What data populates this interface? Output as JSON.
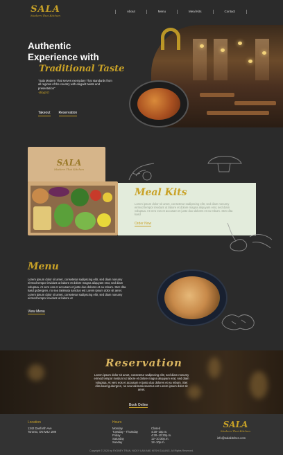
{
  "brand": {
    "logo_main": "SALA",
    "logo_sub": "Modern Thai Kitchen"
  },
  "nav": {
    "items": [
      "About",
      "Menu",
      "Meal Kits",
      "Contact"
    ]
  },
  "hero": {
    "headline_line1": "Authentic",
    "headline_line2": "Experience with",
    "script_title": "Traditional Taste",
    "quote": "\"Sala Modern Thai serves exemplary Thai standards from all regions of the country with elegant twists and presentation\"",
    "cite": "-BlogXO",
    "takeout_label": "Takeout",
    "reservation_label": "Reservation"
  },
  "meal_kits": {
    "title": "Meal Kits",
    "text": "Lorem ipsum dolor sit amet, consetetur sadipscing elitr, sed diam nonumy eirmod tempor invidunt ut labore et dolore magna aliquyam erat, sed diam voluptua. At vero eos et accusam et justo duo dolores et ea rebum. Stet clita kasd",
    "button_label": "Order Now"
  },
  "menu": {
    "title": "Menu",
    "text": "Lorem ipsum dolor sit amet, consetetur sadipscing elitr, sed diam nonumy eirmod tempor invidunt ut labore et dolore magna aliquyam erat, sed diam voluptua. At vero eos et accusam et justo duo dolores et ea rebum. Stet clita kasd gubergren, no sea takimata sanctus est Lorem ipsum dolor sit amet. Lorem ipsum dolor sit amet, consetetur sadipscing elitr, sed diam nonumy eirmod tempor invidunt ut labore et",
    "button_label": "View Menu"
  },
  "reservation": {
    "title": "Reservation",
    "text": "Lorem ipsum dolor sit amet, consetetur sadipscing elitr, sed diam nonumy eirmod tempor invidunt ut labore et dolore magna aliquyam erat, sed diam voluptua. At vero eos et accusam et justo duo dolores et ea rebum. Stet clita kasd gubergren, no sea takimata sanctus est Lorem ipsum dolor sit amet.",
    "button_label": "Book Online"
  },
  "footer": {
    "location_heading": "Location",
    "address_line1": "1342 Danforth Ave",
    "address_line2": "Toronto, ON M4J 1M9",
    "hours_heading": "Hours",
    "hours": [
      {
        "day": "Monday",
        "time": "Closed"
      },
      {
        "day": "Tuesday - Thursday",
        "time": "4:30–10p.m."
      },
      {
        "day": "Friday",
        "time": "4:30–10:30p.m."
      },
      {
        "day": "Saturday",
        "time": "12–10:30p.m."
      },
      {
        "day": "Sunday",
        "time": "12–10p.m."
      }
    ],
    "email": "info@salakitchen.com",
    "copyright": "Copyright © 2020 by SYDNEY TRAN, NICKY LAM AND KESH GALANG. All Rights Reserved."
  },
  "colors": {
    "accent": "#c9a227",
    "background": "#2b2b2b",
    "card": "#e3ecdc",
    "footer": "#333333"
  }
}
